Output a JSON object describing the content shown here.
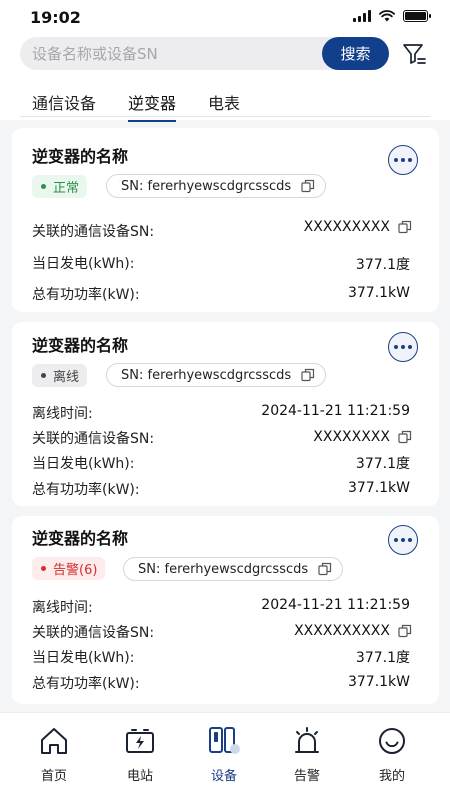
{
  "status": {
    "time": "19:02"
  },
  "search": {
    "placeholder": "设备名称或设备SN",
    "button_label": "搜索"
  },
  "tabs": [
    {
      "label": "通信设备",
      "active": false
    },
    {
      "label": "逆变器",
      "active": true
    },
    {
      "label": "电表",
      "active": false
    }
  ],
  "cards": [
    {
      "title": "逆变器的名称",
      "status": "正常",
      "sn": "SN: fererhyewscdgrcsscds",
      "rows": [
        {
          "label": "关联的通信设备SN:",
          "value": "XXXXXXXXX"
        },
        {
          "label": "当日发电(kWh):",
          "value": "377.1度"
        },
        {
          "label": "总有功功率(kW):",
          "value": "377.1kW"
        }
      ]
    },
    {
      "title": "逆变器的名称",
      "status": "离线",
      "sn": "SN: fererhyewscdgrcsscds",
      "rows": [
        {
          "label": "离线时间:",
          "value": "2024-11-21 11:21:59"
        },
        {
          "label": "关联的通信设备SN:",
          "value": "XXXXXXXX"
        },
        {
          "label": "当日发电(kWh):",
          "value": "377.1度"
        },
        {
          "label": "总有功功率(kW):",
          "value": "377.1kW"
        }
      ]
    },
    {
      "title": "逆变器的名称",
      "status": "告警(6)",
      "sn": "SN: fererhyewscdgrcsscds",
      "rows": [
        {
          "label": "离线时间:",
          "value": "2024-11-21 11:21:59"
        },
        {
          "label": "关联的通信设备SN:",
          "value": "XXXXXXXXXX"
        },
        {
          "label": "当日发电(kWh):",
          "value": "377.1度"
        },
        {
          "label": "总有功功率(kW):",
          "value": "377.1kW"
        }
      ]
    }
  ],
  "nav": [
    {
      "label": "首页",
      "icon": "home-icon",
      "active": false
    },
    {
      "label": "电站",
      "icon": "station-icon",
      "active": false
    },
    {
      "label": "设备",
      "icon": "device-icon",
      "active": true
    },
    {
      "label": "告警",
      "icon": "alarm-icon",
      "active": false
    },
    {
      "label": "我的",
      "icon": "profile-icon",
      "active": false
    }
  ],
  "colors": {
    "accent": "#123f8c",
    "normal": "#2f8f4b",
    "alarm": "#d22e2e",
    "offline": "#444444"
  }
}
